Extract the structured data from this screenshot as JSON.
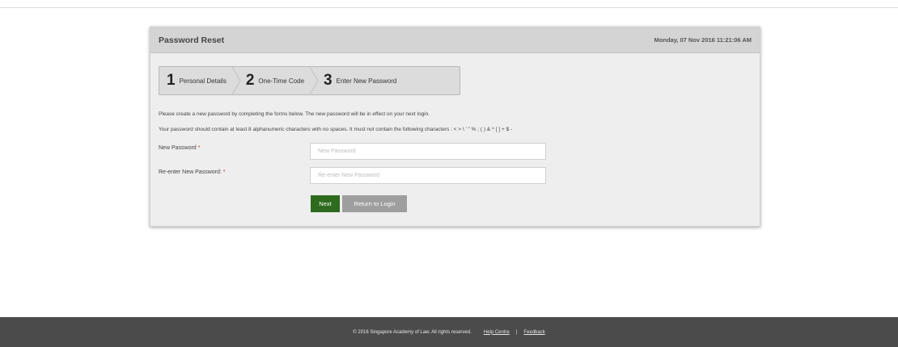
{
  "header": {
    "title": "Password Reset",
    "datetime": "Monday, 07 Nov 2016 11:21:06 AM"
  },
  "steps": [
    {
      "number": "1",
      "label": "Personal Details"
    },
    {
      "number": "2",
      "label": "One-Time Code"
    },
    {
      "number": "3",
      "label": "Enter New Password"
    }
  ],
  "info": {
    "line1": "Please create a new password by completing the forms below. The new password will be in effect on your next login.",
    "line2": "Your password should contain at least 8 alphanumeric characters with no spaces. It must not contain the following characters : < > \\ ' \" % ; ( ) & ^ [ ] + $ -"
  },
  "form": {
    "new_password_label": "New Password",
    "new_password_placeholder": "New Password",
    "reenter_label": "Re-enter New Password:",
    "reenter_placeholder": "Re-enter New Password",
    "required_mark": "*"
  },
  "buttons": {
    "next": "Next",
    "return": "Return to Login"
  },
  "footer": {
    "copyright": "© 2016 Singapore Academy of Law. All rights reserved.",
    "help": "Help Centre",
    "divider": "|",
    "feedback": "Feedback"
  },
  "colors": {
    "next_button": "#2e6b1f",
    "return_button": "#9e9e9e",
    "footer_bg": "#4b4b4b",
    "required": "#c0392b"
  }
}
